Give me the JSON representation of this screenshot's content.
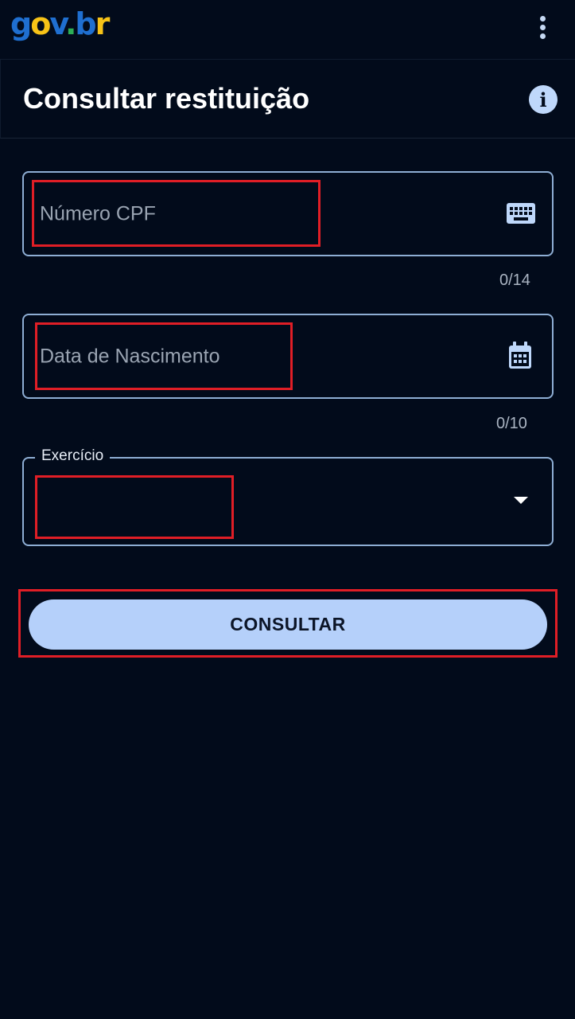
{
  "header": {
    "logo": {
      "g": "g",
      "o": "o",
      "v": "v",
      "dot": ".",
      "b": "b",
      "r": "r"
    },
    "menu_icon": "kebab-menu-icon"
  },
  "title": {
    "text": "Consultar restituição",
    "info_icon": "info-icon",
    "info_glyph": "i"
  },
  "form": {
    "cpf": {
      "placeholder": "Número CPF",
      "counter": "0/14",
      "icon": "keyboard-icon"
    },
    "birth_date": {
      "placeholder": "Data de Nascimento",
      "counter": "0/10",
      "icon": "calendar-icon"
    },
    "exercise": {
      "label": "Exercício",
      "value": "",
      "icon": "dropdown-caret-icon"
    },
    "submit_label": "CONSULTAR"
  },
  "colors": {
    "background": "#020b1b",
    "accent": "#b5d0fa",
    "field_border": "#8eaed4",
    "highlight": "#e01e26"
  }
}
